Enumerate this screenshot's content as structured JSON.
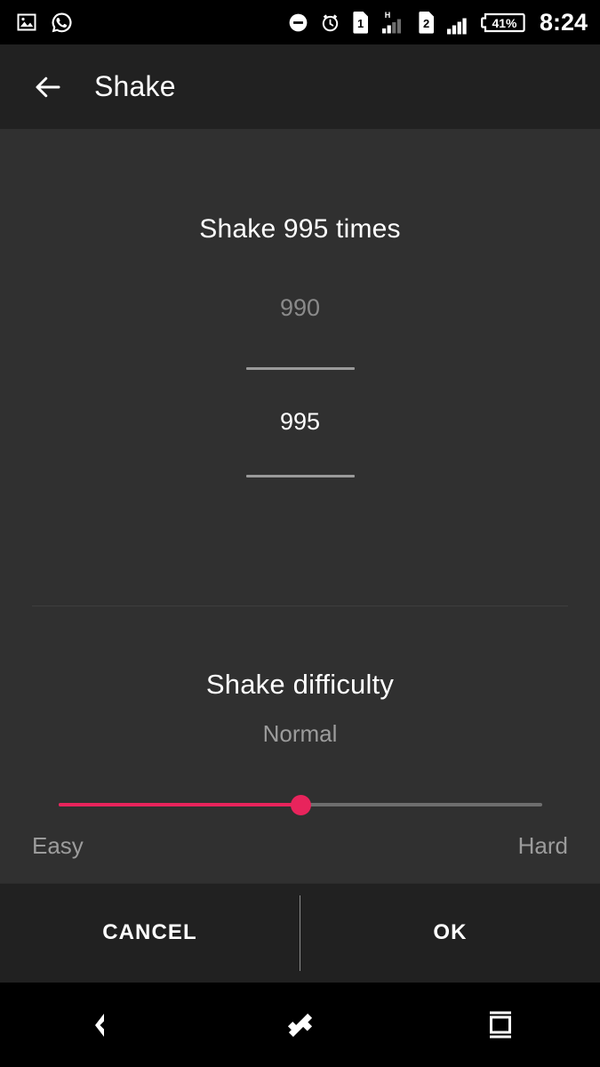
{
  "statusbar": {
    "left_icons": [
      {
        "name": "photo-icon",
        "label": "photo"
      },
      {
        "name": "whatsapp-icon",
        "label": "whatsapp"
      }
    ],
    "right_icons": [
      {
        "name": "do-not-disturb-icon",
        "label": "do-not-disturb"
      },
      {
        "name": "alarm-icon",
        "label": "alarm"
      },
      {
        "name": "sim1-icon",
        "label": "1"
      },
      {
        "name": "signal-h-icon",
        "label": "H"
      },
      {
        "name": "sim2-icon",
        "label": "2"
      },
      {
        "name": "signal-icon",
        "label": "signal"
      },
      {
        "name": "battery-icon",
        "label": "41%"
      }
    ],
    "sim1_label": "1",
    "sim2_label": "2",
    "network_type": "H",
    "battery_percent": "41%",
    "clock": "8:24"
  },
  "appbar": {
    "back_icon": "arrow-back-icon",
    "title": "Shake"
  },
  "main": {
    "count_title": "Shake 995 times",
    "picker": {
      "previous_value": "990",
      "current_value": "995"
    },
    "difficulty": {
      "title": "Shake difficulty",
      "value": "Normal",
      "min_label": "Easy",
      "max_label": "Hard",
      "slider_percent": 50,
      "accent_color": "#E8245C",
      "track_color": "#6e6e6e"
    }
  },
  "buttons": {
    "cancel_label": "CANCEL",
    "ok_label": "OK"
  },
  "navbar": {
    "back_icon": "nav-back-icon",
    "home_icon": "nav-home-icon",
    "recents_icon": "nav-recents-icon"
  },
  "theme": {
    "status_bg": "#000000",
    "appbar_bg": "#212121",
    "content_bg": "#303030",
    "buttonbar_bg": "#212121",
    "navbar_bg": "#000000"
  }
}
